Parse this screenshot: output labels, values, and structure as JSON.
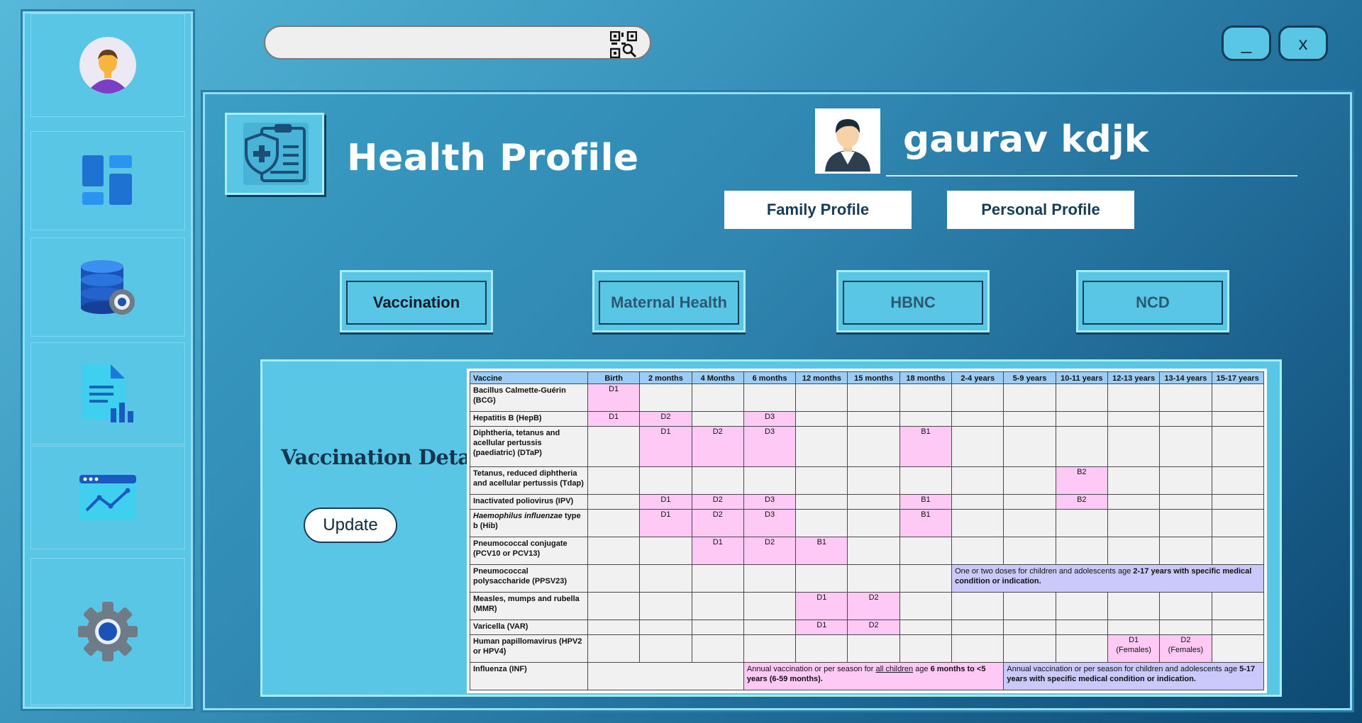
{
  "search": {
    "placeholder": ""
  },
  "window": {
    "minimize_label": "_",
    "close_label": "x"
  },
  "header": {
    "title": "Health Profile",
    "user_name": "gaurav kdjk"
  },
  "profile_buttons": {
    "family": "Family Profile",
    "personal": "Personal Profile"
  },
  "tabs": [
    {
      "label": "Vaccination",
      "active": true
    },
    {
      "label": "Maternal Health",
      "active": false
    },
    {
      "label": "HBNC",
      "active": false
    },
    {
      "label": "NCD",
      "active": false
    }
  ],
  "vaccination": {
    "section_label": "Vaccination Details :",
    "update_label": "Update",
    "table": {
      "headers": [
        "Vaccine",
        "Birth",
        "2 months",
        "4 Months",
        "6 months",
        "12 months",
        "15 months",
        "18 months",
        "2-4 years",
        "5-9 years",
        "10-11 years",
        "12-13 years",
        "13-14 years",
        "15-17 years"
      ],
      "rows": [
        {
          "vaccine": "Bacillus Calmette-Guérin (BCG)",
          "cells": [
            "D1",
            "",
            "",
            "",
            "",
            "",
            "",
            "",
            "",
            "",
            "",
            "",
            ""
          ]
        },
        {
          "vaccine": "Hepatitis B (HepB)",
          "cells": [
            "D1",
            "D2",
            "",
            "D3",
            "",
            "",
            "",
            "",
            "",
            "",
            "",
            "",
            ""
          ]
        },
        {
          "vaccine": "Diphtheria, tetanus and acellular pertussis (paediatric) (DTaP)",
          "cells": [
            "",
            "D1",
            "D2",
            "D3",
            "",
            "",
            "B1",
            "",
            "",
            "",
            "",
            "",
            ""
          ]
        },
        {
          "vaccine": "Tetanus, reduced diphtheria and acellular pertussis (Tdap)",
          "cells": [
            "",
            "",
            "",
            "",
            "",
            "",
            "",
            "",
            "",
            "B2",
            "",
            "",
            ""
          ]
        },
        {
          "vaccine": "Inactivated poliovirus (IPV)",
          "cells": [
            "",
            "D1",
            "D2",
            "D3",
            "",
            "",
            "B1",
            "",
            "",
            "B2",
            "",
            "",
            ""
          ]
        },
        {
          "vaccine_italic": "Haemophilus influenzae",
          "vaccine_rest": " type b (Hib)",
          "cells": [
            "",
            "D1",
            "D2",
            "D3",
            "",
            "",
            "B1",
            "",
            "",
            "",
            "",
            "",
            ""
          ]
        },
        {
          "vaccine": "Pneumococcal conjugate (PCV10 or PCV13)",
          "cells": [
            "",
            "",
            "D1",
            "D2",
            "B1",
            "",
            "",
            "",
            "",
            "",
            "",
            "",
            ""
          ]
        },
        {
          "vaccine": "Pneumococcal polysaccharide (PPSV23)",
          "note_pre": "One or two doses for children and adolescents age ",
          "note_bold": "2-17 years with specific medical condition or indication."
        },
        {
          "vaccine": "Measles, mumps and rubella (MMR)",
          "cells": [
            "",
            "",
            "",
            "",
            "D1",
            "D2",
            "",
            "",
            "",
            "",
            "",
            "",
            ""
          ]
        },
        {
          "vaccine": "Varicella (VAR)",
          "cells": [
            "",
            "",
            "",
            "",
            "D1",
            "D2",
            "",
            "",
            "",
            "",
            "",
            "",
            ""
          ]
        },
        {
          "vaccine": "Human papillomavirus (HPV2 or HPV4)",
          "cells": [
            "",
            "",
            "",
            "",
            "",
            "",
            "",
            "",
            "",
            "",
            "D1 (Females)",
            "D2 (Females)",
            ""
          ]
        },
        {
          "vaccine": "Influenza (INF)",
          "note1_pre": "Annual vaccination or per season for ",
          "note1_u": "all children",
          "note1_mid": " age ",
          "note1_bold": "6 months to <5 years (6-59 months).",
          "note2_pre": "Annual vaccination or per season for children and adolescents age ",
          "note2_bold": "5-17 years with specific medical condition or indication."
        }
      ]
    }
  },
  "colors": {
    "sidebar": "#5ac6e6",
    "header_cell": "#9ccdf6",
    "dose_cell": "#ffc9f5",
    "note_cell": "#cbc9fb",
    "title_text": "#ffffff"
  },
  "icons": [
    "user-avatar-icon",
    "dashboard-icon",
    "database-settings-icon",
    "report-icon",
    "analytics-icon",
    "settings-icon",
    "qr-search-icon",
    "health-clipboard-icon",
    "profile-avatar-icon"
  ]
}
